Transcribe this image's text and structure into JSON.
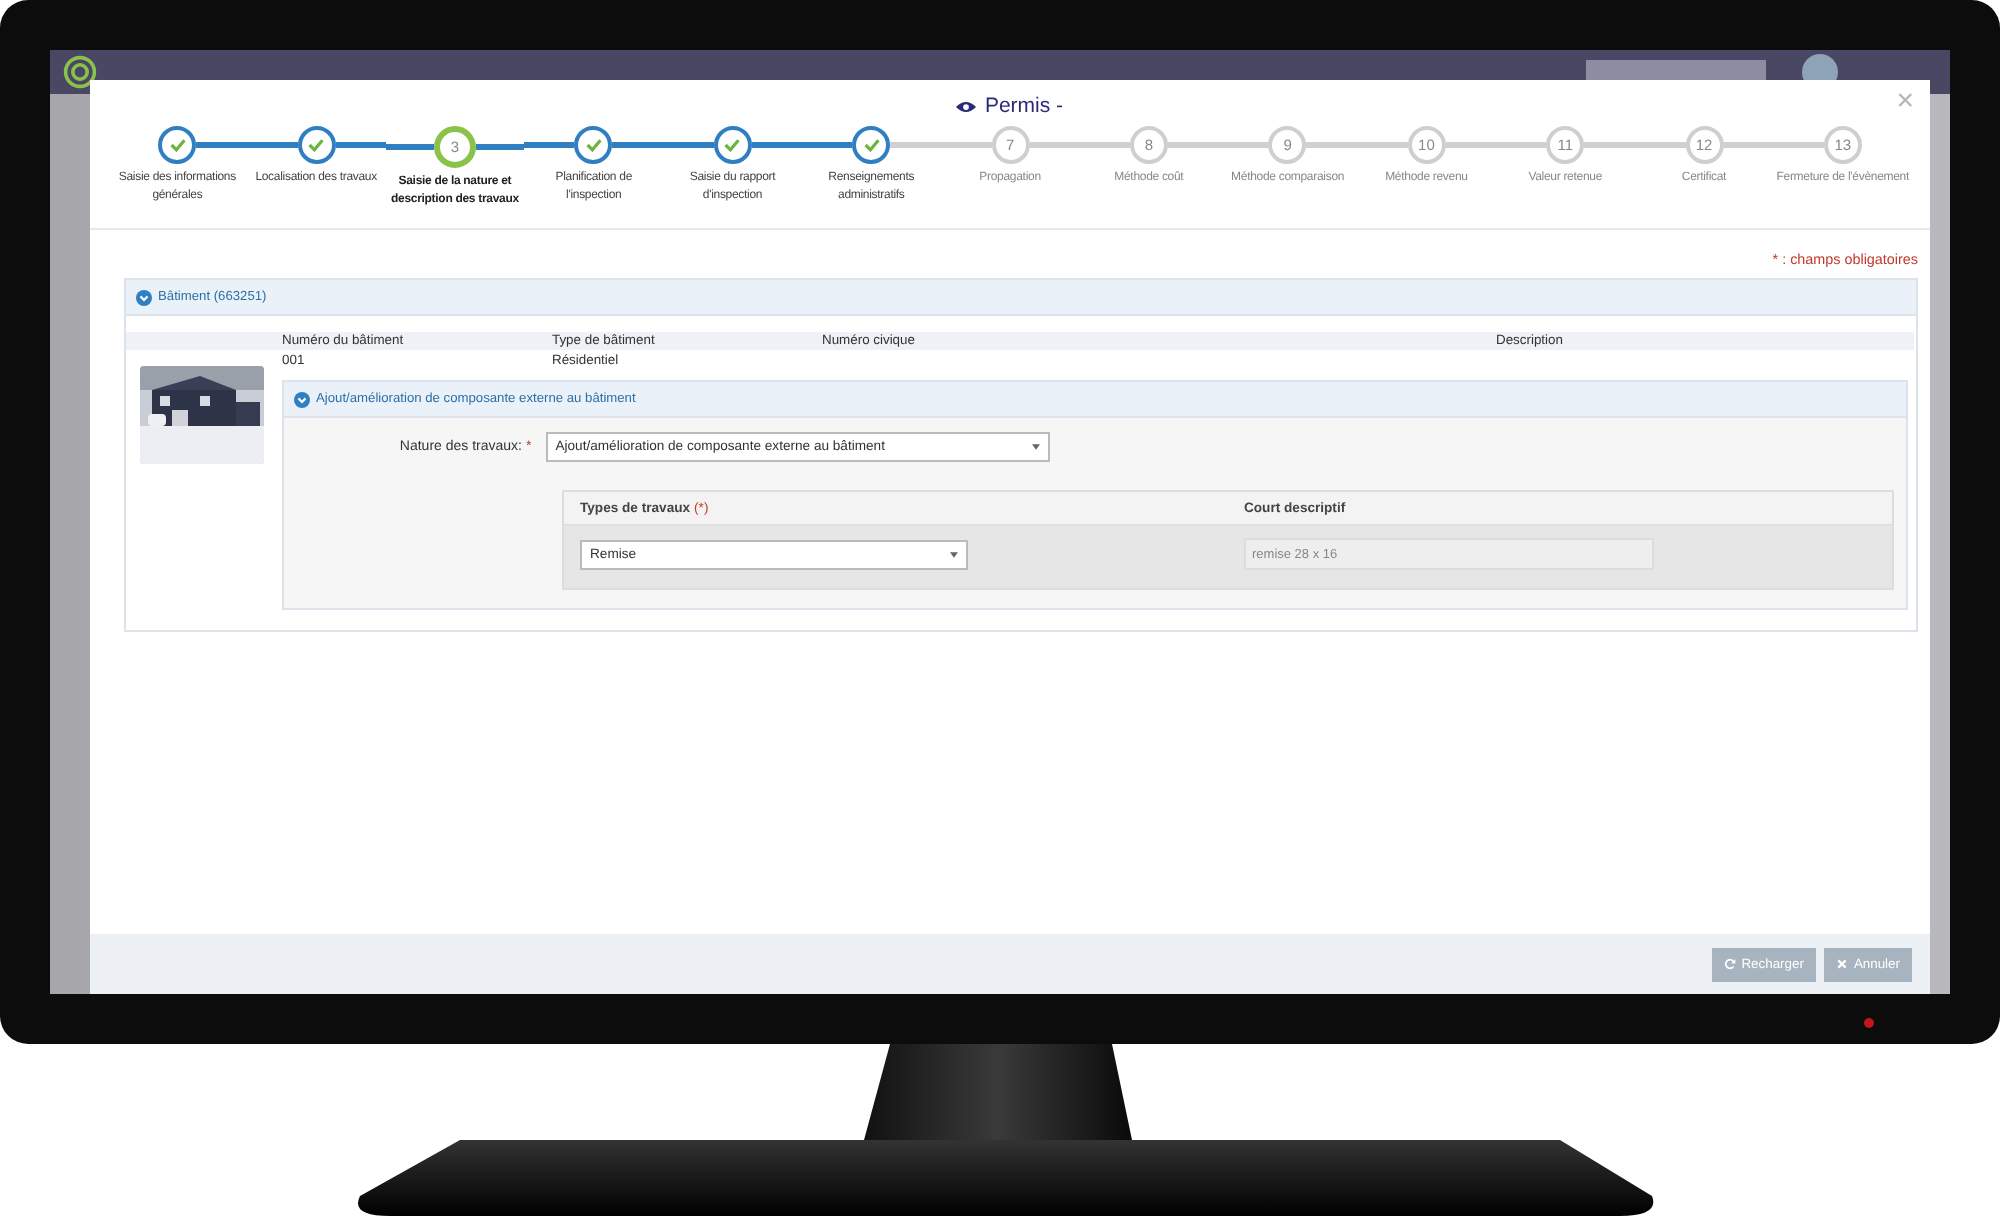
{
  "modal": {
    "title": "Permis -",
    "close": "×"
  },
  "steps": [
    {
      "label": "Saisie des informations générales",
      "kind": "done",
      "selected": false
    },
    {
      "label": "Localisation des travaux",
      "kind": "done",
      "selected": false
    },
    {
      "number": "3",
      "label": "Saisie de la nature et description des travaux",
      "kind": "todo",
      "selected": true
    },
    {
      "label": "Planification de l'inspection",
      "kind": "done",
      "selected": false
    },
    {
      "label": "Saisie du rapport d'inspection",
      "kind": "done",
      "selected": false
    },
    {
      "label": "Renseignements administratifs",
      "kind": "done",
      "selected": false
    },
    {
      "number": "7",
      "label": "Propagation",
      "kind": "todo",
      "selected": false
    },
    {
      "number": "8",
      "label": "Méthode coût",
      "kind": "todo",
      "selected": false
    },
    {
      "number": "9",
      "label": "Méthode comparaison",
      "kind": "todo",
      "selected": false
    },
    {
      "number": "10",
      "label": "Méthode revenu",
      "kind": "todo",
      "selected": false
    },
    {
      "number": "11",
      "label": "Valeur retenue",
      "kind": "todo",
      "selected": false
    },
    {
      "number": "12",
      "label": "Certificat",
      "kind": "todo",
      "selected": false
    },
    {
      "number": "13",
      "label": "Fermeture de l'évènement",
      "kind": "todo",
      "selected": false
    }
  ],
  "required_note": "* : champs obligatoires",
  "building_panel": {
    "title": "Bâtiment (663251)",
    "columns": [
      "Numéro du bâtiment",
      "Type de bâtiment",
      "Numéro civique",
      "Description"
    ],
    "values": [
      "001",
      "Résidentiel"
    ],
    "work_panel": {
      "title": "Ajout/amélioration de composante externe au bâtiment",
      "nature_label": "Nature des travaux:",
      "nature_required": "*",
      "nature_value": "Ajout/amélioration de composante externe au bâtiment",
      "types_header": "Types de travaux",
      "types_required": "(*)",
      "short_header": "Court descriptif",
      "type_value": "Remise",
      "short_value": "remise 28 x 16"
    }
  },
  "footer": {
    "buttons": [
      {
        "label": "Recharger",
        "kind": "reload"
      },
      {
        "label": "Annuler",
        "kind": "cancel"
      }
    ]
  }
}
